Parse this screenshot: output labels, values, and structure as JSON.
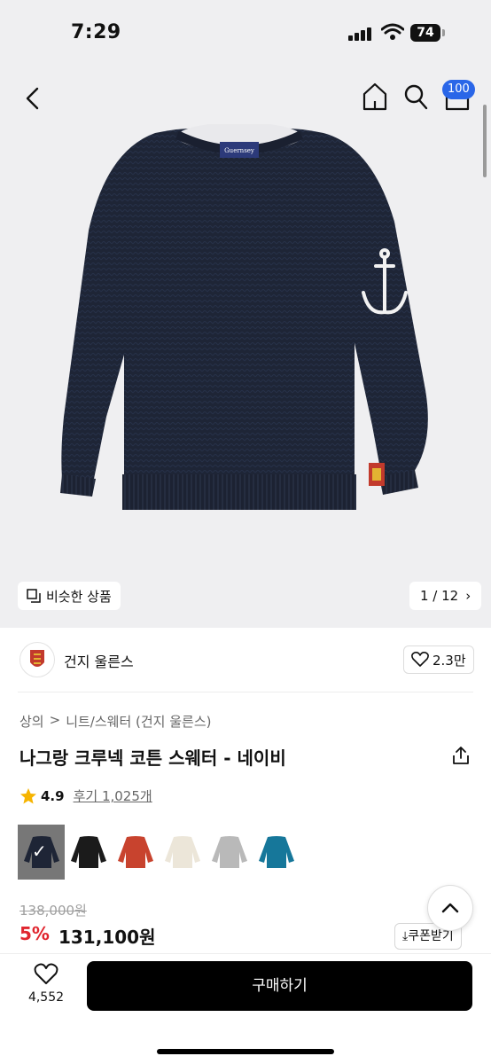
{
  "status_bar": {
    "time": "7:29",
    "battery": "74"
  },
  "header": {
    "cart_count": "100"
  },
  "gallery": {
    "similar_label": "비슷한 상품",
    "counter": "1 / 12",
    "counter_arrow": "›"
  },
  "brand": {
    "name": "건지 울른스",
    "likes": "2.3만"
  },
  "breadcrumb": {
    "level1": "상의",
    "separator": ">",
    "level2": "니트/스웨터 (건지 울른스)"
  },
  "product": {
    "title": "나그랑 크루넥 코튼 스웨터 - 네이비"
  },
  "rating": {
    "score": "4.9",
    "reviews": "후기 1,025개"
  },
  "swatches": [
    {
      "color": "#1e2536",
      "selected": true
    },
    {
      "color": "#1b1b1b",
      "selected": false
    },
    {
      "color": "#c8432e",
      "selected": false
    },
    {
      "color": "#ece6d9",
      "selected": false
    },
    {
      "color": "#b9b9b9",
      "selected": false
    },
    {
      "color": "#16779a",
      "selected": false
    }
  ],
  "pricing": {
    "original": "138,000원",
    "discount": "5%",
    "price": "131,100원",
    "coupon_label": "쿠폰받기"
  },
  "bottom_bar": {
    "wish_count": "4,552",
    "buy_label": "구매하기"
  },
  "colors": {
    "accent_blue": "#2a66e8",
    "discount_red": "#e0252e",
    "sweater_navy": "#1e2536"
  }
}
